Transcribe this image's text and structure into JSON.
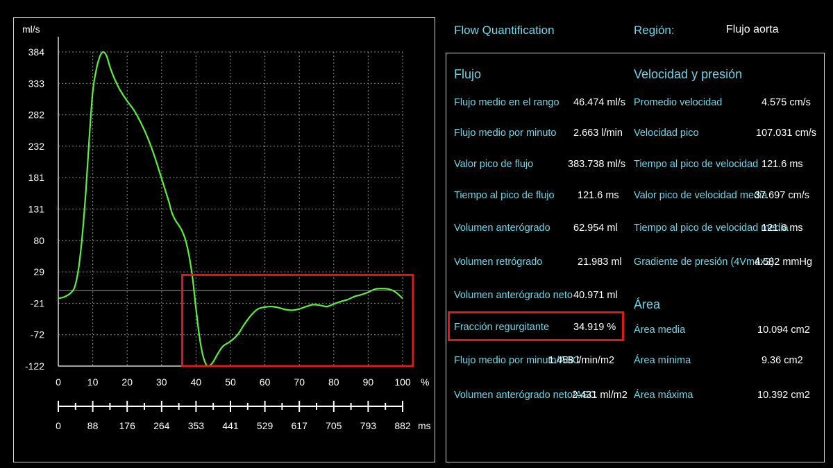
{
  "header": {
    "title": "Flow Quantification",
    "region_label": "Región:",
    "region_value": "Flujo aorta"
  },
  "chart_data": {
    "type": "line",
    "ylabel": "ml/s",
    "y_ticks": [
      "384",
      "333",
      "282",
      "232",
      "181",
      "131",
      "80",
      "29",
      "-21",
      "-72",
      "-122"
    ],
    "ylim": [
      -122,
      384
    ],
    "x_percent_ticks": [
      "0",
      "10",
      "20",
      "30",
      "40",
      "50",
      "60",
      "70",
      "80",
      "90",
      "100"
    ],
    "x_percent_unit": "%",
    "x_ms_ticks": [
      "0",
      "88",
      "176",
      "264",
      "353",
      "441",
      "529",
      "617",
      "705",
      "793",
      "882"
    ],
    "x_ms_unit": "ms",
    "xlim": [
      0,
      100
    ],
    "zero_line": 0,
    "grid": true,
    "line_color": "#5cf03a",
    "highlight_color": "#e01818",
    "highlight_range_percent": [
      36,
      103
    ],
    "series": [
      {
        "x": [
          0,
          2,
          4,
          5,
          6,
          7,
          8,
          9,
          10,
          11,
          12,
          13,
          14,
          15,
          16,
          17,
          18,
          20,
          22,
          24,
          26,
          28,
          30,
          32,
          33,
          34,
          35,
          36,
          37,
          38,
          39,
          40,
          41,
          42,
          43,
          44,
          45,
          46,
          47,
          48,
          50,
          52,
          54,
          56,
          58,
          60,
          62,
          64,
          66,
          68,
          70,
          72,
          74,
          76,
          78,
          80,
          82,
          84,
          86,
          88,
          90,
          92,
          94,
          96,
          98,
          100
        ],
        "y": [
          -13,
          -10,
          -2,
          10,
          40,
          90,
          160,
          245,
          320,
          355,
          376,
          384,
          378,
          360,
          345,
          333,
          322,
          305,
          290,
          270,
          245,
          215,
          180,
          145,
          125,
          113,
          105,
          95,
          80,
          55,
          20,
          -30,
          -75,
          -105,
          -120,
          -121,
          -115,
          -105,
          -96,
          -89,
          -82,
          -72,
          -55,
          -40,
          -30,
          -27,
          -26,
          -28,
          -31,
          -32,
          -30,
          -26,
          -23,
          -24,
          -26,
          -22,
          -18,
          -15,
          -10,
          -7,
          -3,
          2,
          3,
          2,
          -3,
          -13
        ]
      }
    ]
  },
  "flujo": {
    "title": "Flujo",
    "rows": [
      {
        "label": "Flujo medio en el rango",
        "value": "46.474 ml/s"
      },
      {
        "label": "Flujo medio por minuto",
        "value": "2.663 l/min"
      },
      {
        "label": "Valor pico de flujo",
        "value": "383.738 ml/s"
      },
      {
        "label": "Tiempo al pico de flujo",
        "value": "121.6 ms"
      },
      {
        "label": "Volumen anterógrado",
        "value": "62.954 ml"
      },
      {
        "label": "Volumen retrógrado",
        "value": "21.983 ml"
      },
      {
        "label": "Volumen anterógrado neto",
        "value": "40.971 ml"
      },
      {
        "label": "Fracción regurgitante",
        "value": "34.919 %"
      },
      {
        "label": "Flujo medio por minuto/ASC",
        "value": "1.458 l/min/m2"
      },
      {
        "label": "Volumen anterógrado neto/ASC",
        "value": "2.431 ml/m2"
      }
    ]
  },
  "velocidad": {
    "title": "Velocidad y presión",
    "rows": [
      {
        "label": "Promedio velocidad",
        "value": "4.575 cm/s"
      },
      {
        "label": "Velocidad pico",
        "value": "107.031 cm/s"
      },
      {
        "label": "Tiempo al pico de velocidad",
        "value": "121.6 ms"
      },
      {
        "label": "Valor pico de velocidad media",
        "value": "37.697 cm/s"
      },
      {
        "label": "Tiempo al pico de velocidad media",
        "value": "121.6 ms"
      },
      {
        "label": "Gradiente de presión (4Vmáx2)",
        "value": "4.582 mmHg"
      }
    ]
  },
  "area": {
    "title": "Área",
    "rows": [
      {
        "label": "Área media",
        "value": "10.094 cm2"
      },
      {
        "label": "Área mínima",
        "value": "9.36 cm2"
      },
      {
        "label": "Área máxima",
        "value": "10.392 cm2"
      }
    ]
  }
}
